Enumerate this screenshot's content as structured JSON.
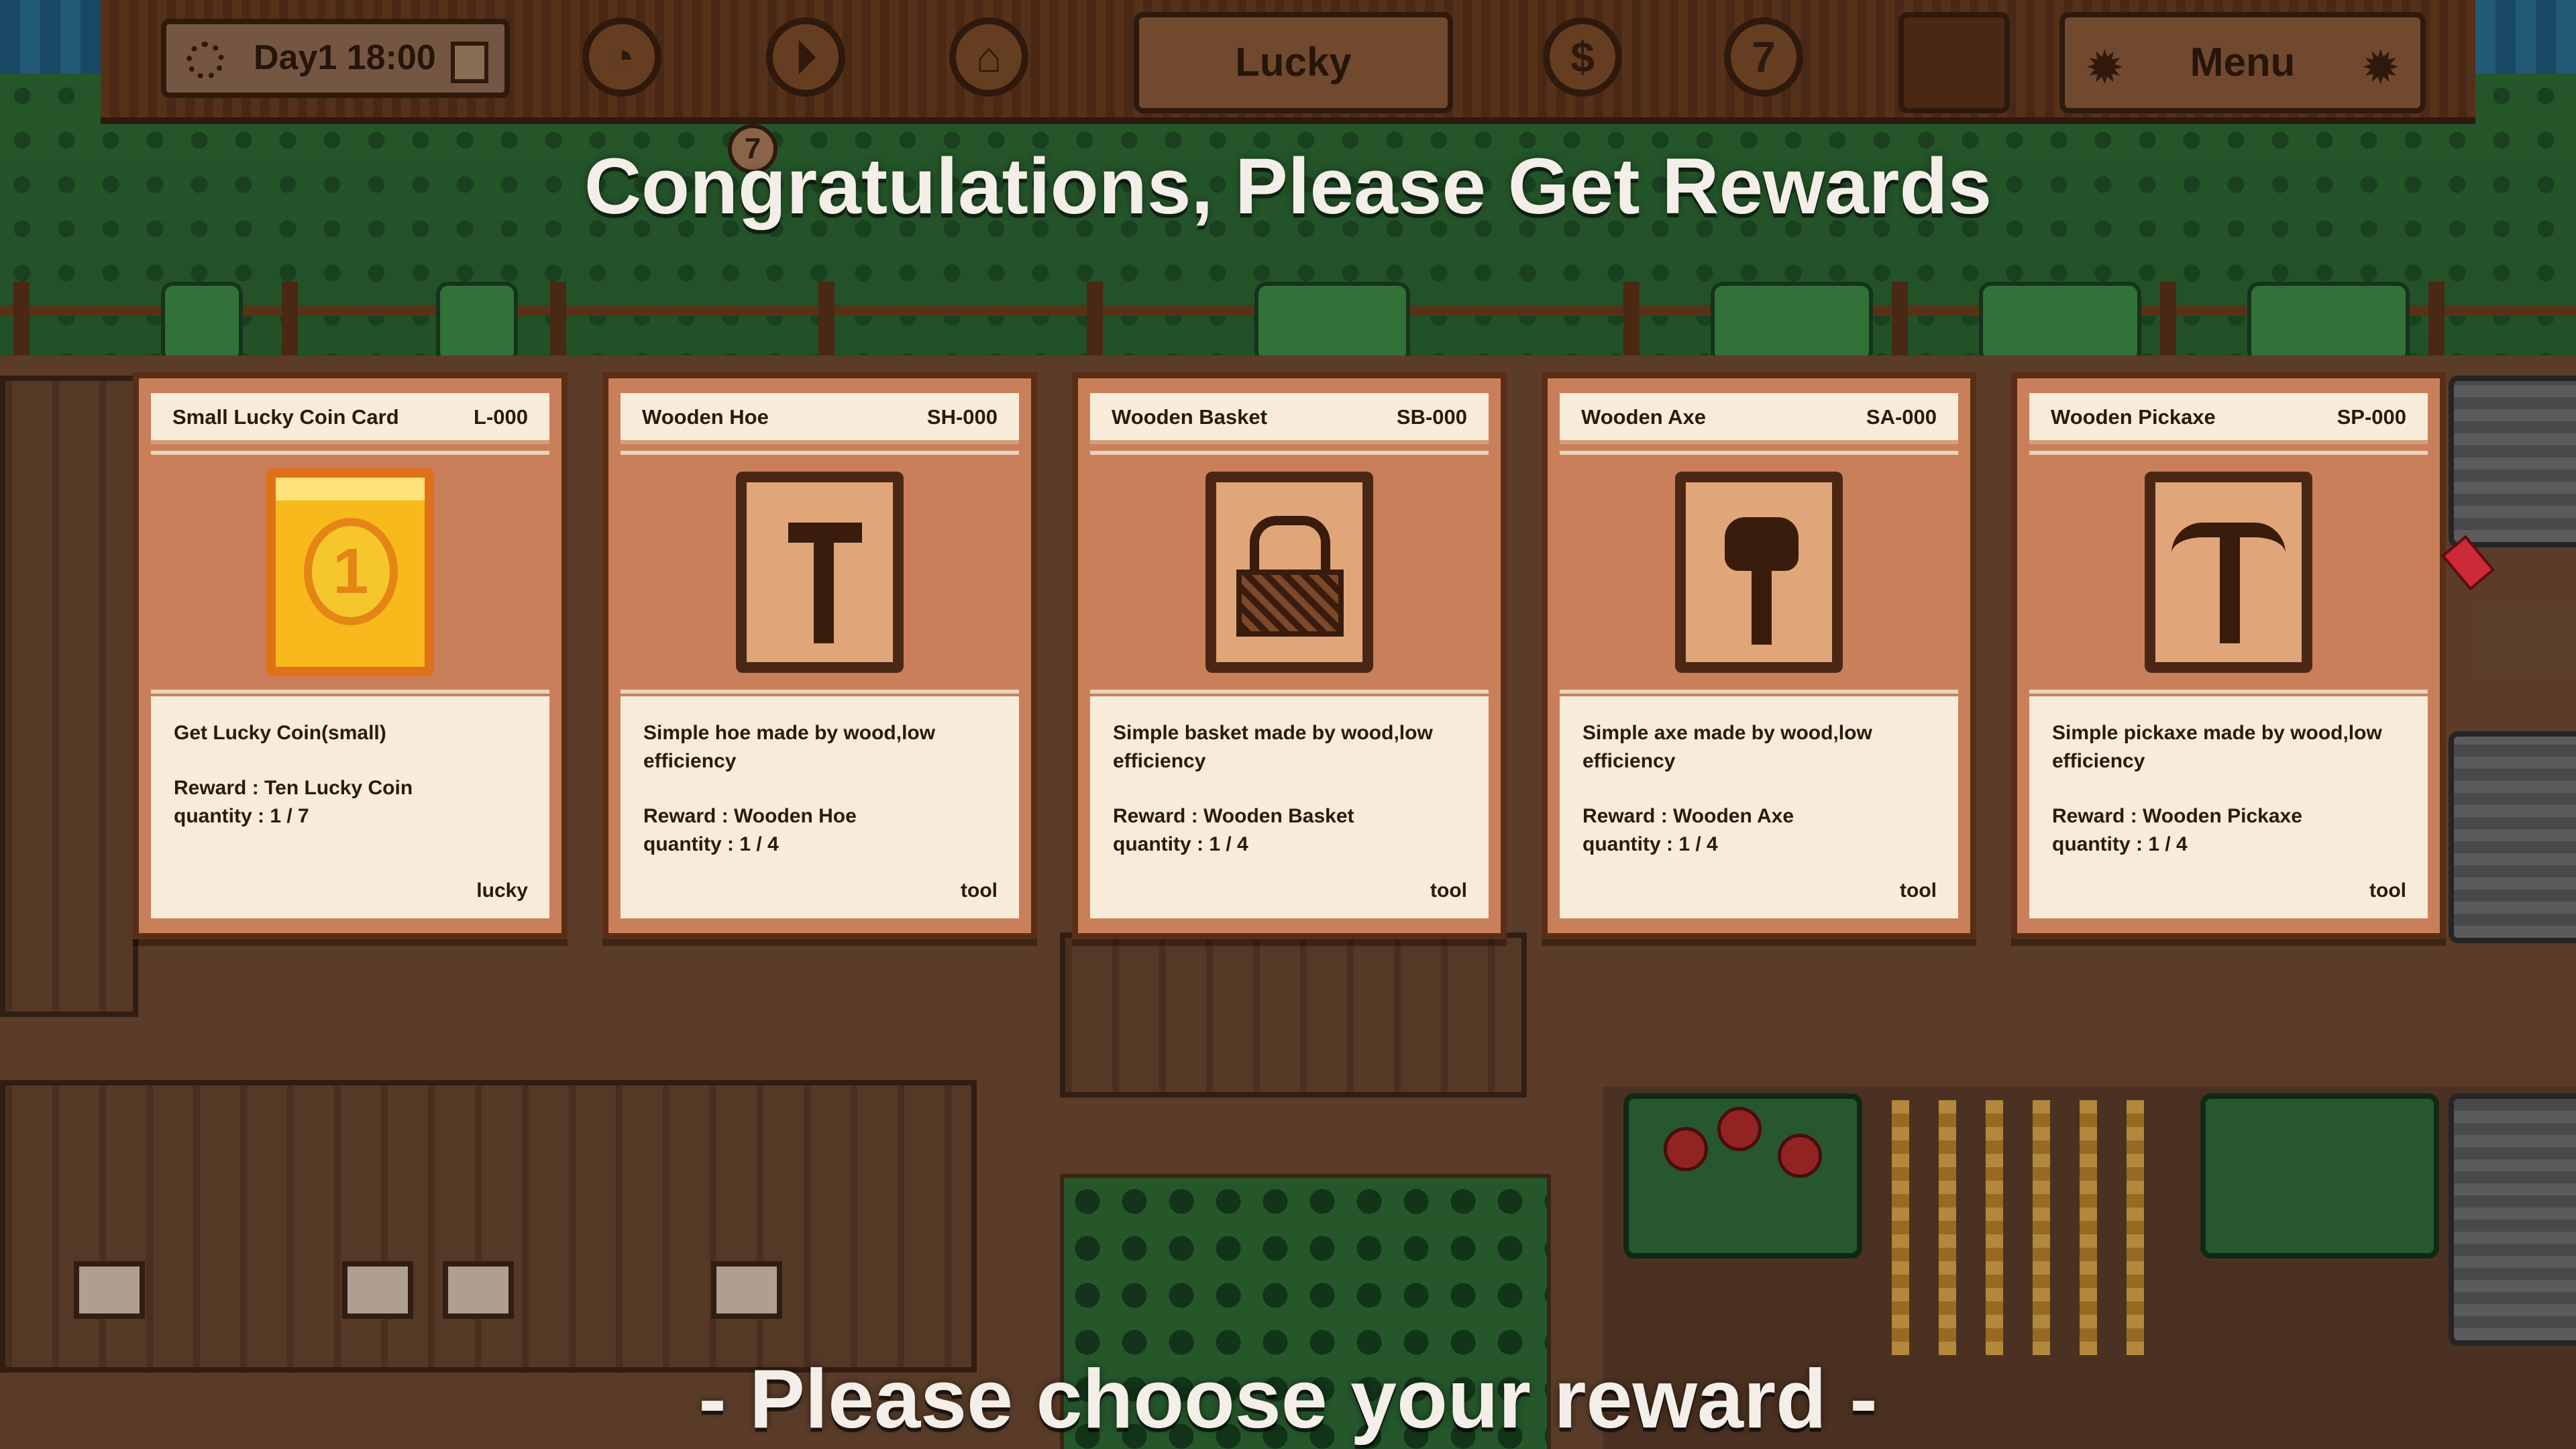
{
  "hud": {
    "time": "Day1 18:00",
    "location": "Lucky",
    "menu": "Menu",
    "badge": "7",
    "round_button_glyphs": [
      "◔",
      "⏵",
      "⌂",
      "$",
      "7"
    ]
  },
  "title": "Congratulations, Please Get Rewards",
  "subtitle": "- Please choose your reward -",
  "cards": [
    {
      "name": "Small Lucky Coin Card",
      "code": "L-000",
      "desc": "Get Lucky Coin(small)",
      "reward": "Reward : Ten Lucky Coin",
      "quantity": "quantity : 1 / 7",
      "tag": "lucky",
      "icon": "lucky-coin-icon",
      "coin_digit": "1"
    },
    {
      "name": "Wooden Hoe",
      "code": "SH-000",
      "desc": "Simple hoe made by wood,low efficiency",
      "reward": "Reward : Wooden Hoe",
      "quantity": "quantity : 1 / 4",
      "tag": "tool",
      "icon": "hoe-icon"
    },
    {
      "name": "Wooden Basket",
      "code": "SB-000",
      "desc": "Simple basket made by wood,low efficiency",
      "reward": "Reward : Wooden Basket",
      "quantity": "quantity : 1 / 4",
      "tag": "tool",
      "icon": "basket-icon"
    },
    {
      "name": "Wooden Axe",
      "code": "SA-000",
      "desc": "Simple axe made by wood,low efficiency",
      "reward": "Reward : Wooden Axe",
      "quantity": "quantity : 1 / 4",
      "tag": "tool",
      "icon": "axe-icon"
    },
    {
      "name": "Wooden Pickaxe",
      "code": "SP-000",
      "desc": "Simple pickaxe made by wood,low efficiency",
      "reward": "Reward : Wooden Pickaxe",
      "quantity": "quantity : 1 / 4",
      "tag": "tool",
      "icon": "pickaxe-icon"
    }
  ]
}
